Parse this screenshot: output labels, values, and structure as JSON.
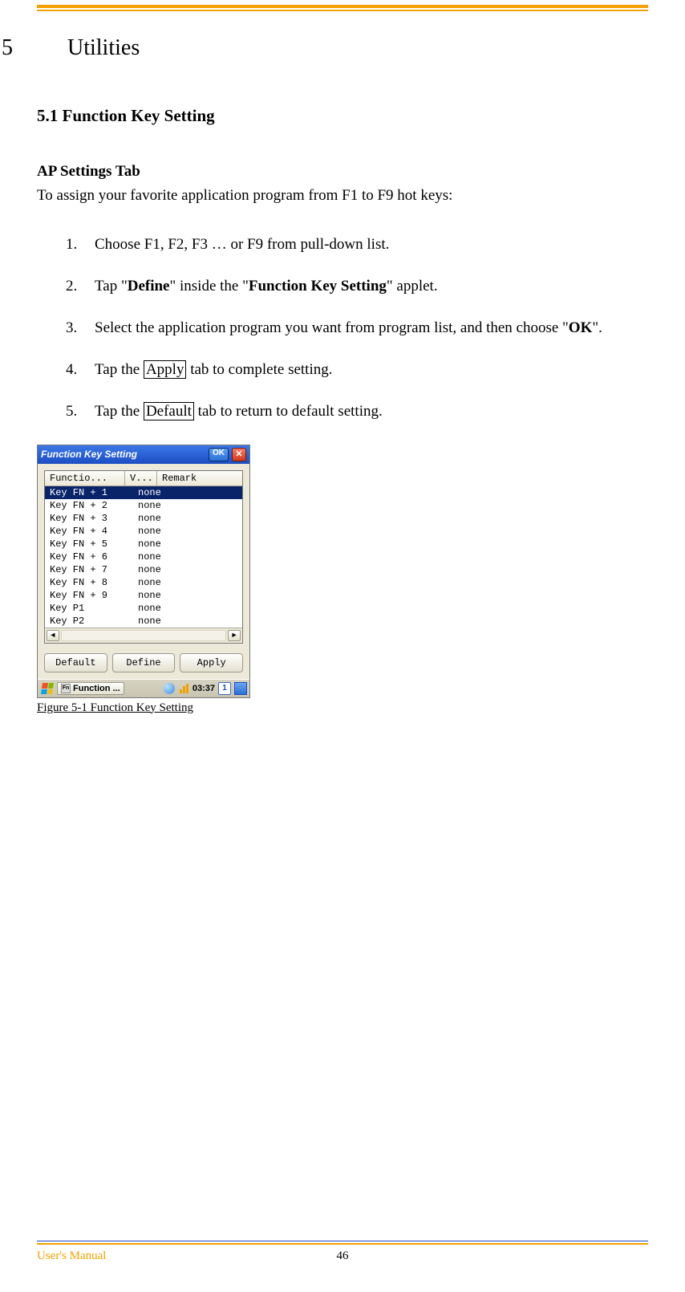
{
  "chapter": {
    "number": "5",
    "title": "Utilities"
  },
  "subsection": {
    "label": "5.1  Function Key Setting"
  },
  "apTab": {
    "heading": "AP Settings Tab",
    "intro": "To assign your favorite application program from F1 to F9 hot keys:"
  },
  "steps": {
    "s1": {
      "n": "1.",
      "t": "Choose F1, F2, F3 … or F9 from pull-down list."
    },
    "s2": {
      "n": "2.",
      "pre": "Tap \"",
      "b1": "Define",
      "mid": "\" inside the \"",
      "b2": "Function Key Setting",
      "post": "\" applet."
    },
    "s3": {
      "n": "3.",
      "pre": "Select the application program you want from program list, and then choose \"",
      "b1": "OK",
      "post": "\"."
    },
    "s4": {
      "n": "4.",
      "pre": "Tap the ",
      "box": "Apply",
      "post": " tab to complete setting."
    },
    "s5": {
      "n": "5.",
      "pre": "Tap the ",
      "box": "Default",
      "post": " tab to return to default setting."
    }
  },
  "figure": {
    "caption": "Figure 5-1 Function Key Setting"
  },
  "window": {
    "title": "Function Key Setting",
    "ok": "OK",
    "close": "✕",
    "headers": {
      "c1": "Functio...",
      "c2": "V...",
      "c3": "Remark"
    },
    "rows": [
      {
        "key": "Key FN + 1",
        "remark": "none",
        "selected": true
      },
      {
        "key": "Key FN + 2",
        "remark": "none",
        "selected": false
      },
      {
        "key": "Key FN + 3",
        "remark": "none",
        "selected": false
      },
      {
        "key": "Key FN + 4",
        "remark": "none",
        "selected": false
      },
      {
        "key": "Key FN + 5",
        "remark": "none",
        "selected": false
      },
      {
        "key": "Key FN + 6",
        "remark": "none",
        "selected": false
      },
      {
        "key": "Key FN + 7",
        "remark": "none",
        "selected": false
      },
      {
        "key": "Key FN + 8",
        "remark": "none",
        "selected": false
      },
      {
        "key": "Key FN + 9",
        "remark": "none",
        "selected": false
      },
      {
        "key": "Key P1",
        "remark": "none",
        "selected": false
      },
      {
        "key": "Key P2",
        "remark": "none",
        "selected": false
      }
    ],
    "buttons": {
      "default": "Default",
      "define": "Define",
      "apply": "Apply"
    },
    "taskbar": {
      "task": "Function ...",
      "fn": "Fn",
      "time": "03:37",
      "kbd": "1"
    }
  },
  "footer": {
    "left": "User's Manual",
    "pageno": "46"
  }
}
